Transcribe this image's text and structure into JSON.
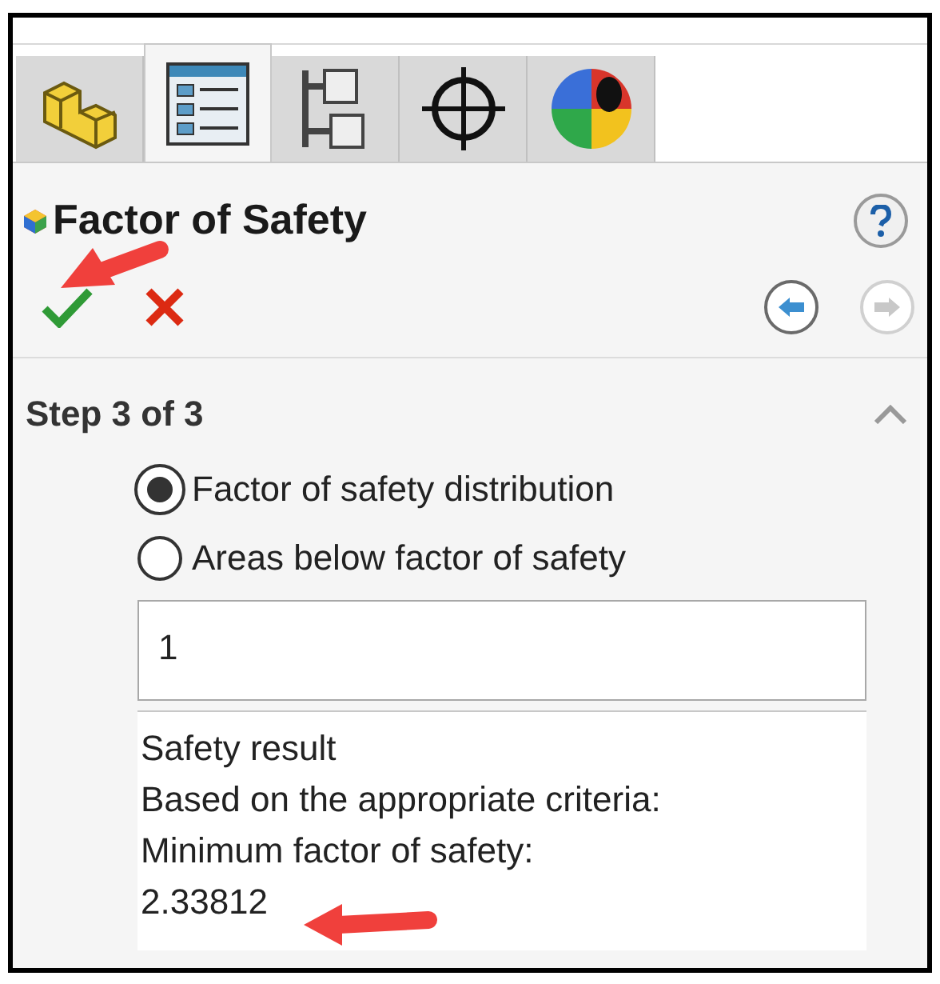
{
  "tabs": [
    {
      "kind": "part",
      "selected": false
    },
    {
      "kind": "property",
      "selected": true
    },
    {
      "kind": "config",
      "selected": false
    },
    {
      "kind": "target",
      "selected": false
    },
    {
      "kind": "display",
      "selected": false
    }
  ],
  "panel": {
    "title": "Factor of Safety"
  },
  "section": {
    "title": "Step 3 of 3",
    "expanded": true
  },
  "options": [
    {
      "label": "Factor of safety distribution",
      "selected": true
    },
    {
      "label": "Areas below factor of safety",
      "selected": false
    }
  ],
  "value_field": {
    "value": "1"
  },
  "result_lines": [
    "Safety result",
    "Based on the appropriate criteria:",
    "Minimum factor of safety:",
    "2.33812"
  ]
}
